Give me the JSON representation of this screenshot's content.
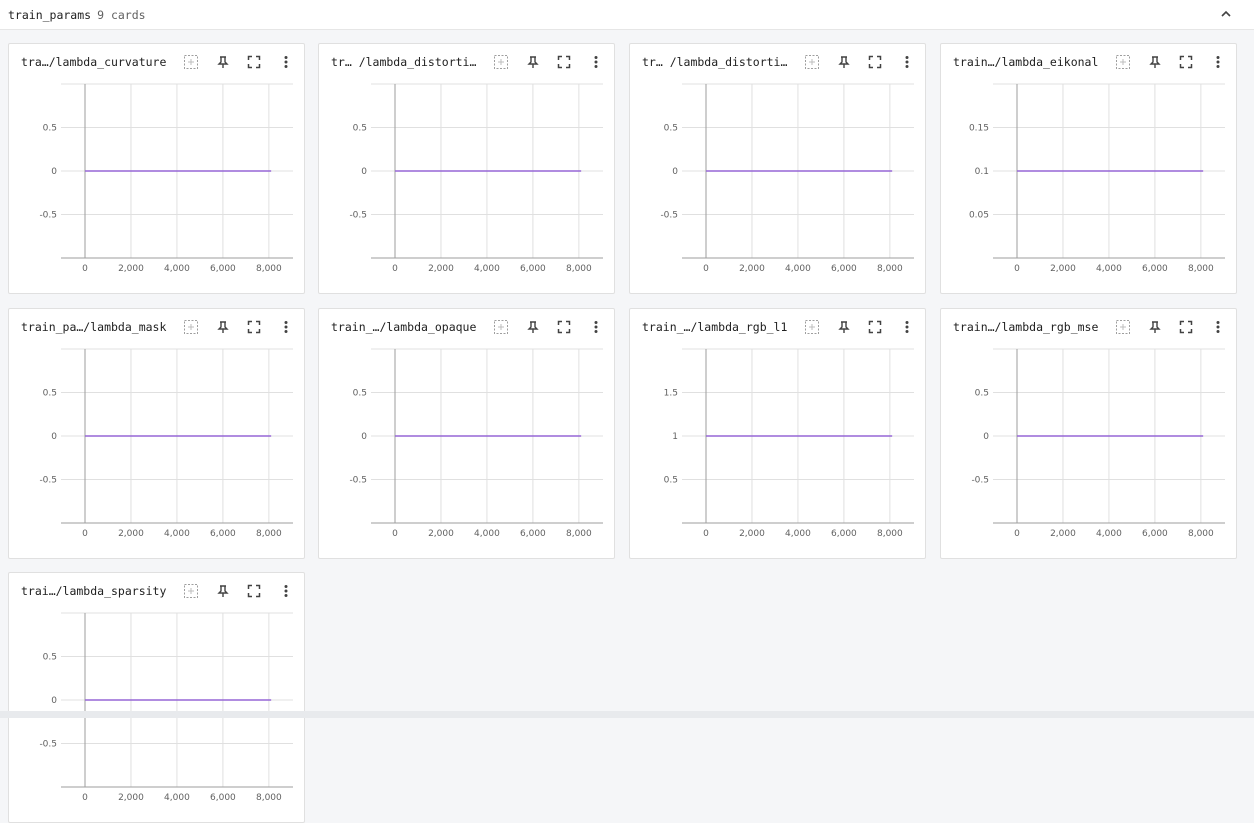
{
  "header": {
    "title": "train_params",
    "count": "9 cards"
  },
  "colors": {
    "line": "#9567d6",
    "grid": "#e0e0e0",
    "axis": "#9e9e9e"
  },
  "icons": [
    "fit-domain-icon",
    "pin-icon",
    "fullscreen-icon",
    "more-vert-icon"
  ],
  "cards": [
    {
      "title": "tra…/lambda_curvature",
      "yticks": [
        "0.5",
        "0",
        "-0.5"
      ]
    },
    {
      "title": "tr… /lambda_distorti…",
      "yticks": [
        "0.5",
        "0",
        "-0.5"
      ]
    },
    {
      "title": "tr… /lambda_distorti…",
      "yticks": [
        "0.5",
        "0",
        "-0.5"
      ]
    },
    {
      "title": "train…/lambda_eikonal",
      "yticks": [
        "0.15",
        "0.1",
        "0.05"
      ]
    },
    {
      "title": "train_pa…/lambda_mask",
      "yticks": [
        "0.5",
        "0",
        "-0.5"
      ]
    },
    {
      "title": "train_…/lambda_opaque",
      "yticks": [
        "0.5",
        "0",
        "-0.5"
      ]
    },
    {
      "title": "train_…/lambda_rgb_l1",
      "yticks": [
        "1.5",
        "1",
        "0.5"
      ]
    },
    {
      "title": "train…/lambda_rgb_mse",
      "yticks": [
        "0.5",
        "0",
        "-0.5"
      ]
    },
    {
      "title": "trai…/lambda_sparsity",
      "yticks": [
        "0.5",
        "0",
        "-0.5"
      ]
    }
  ],
  "chart_data": [
    {
      "type": "line",
      "x": [
        0,
        8100
      ],
      "series": [
        {
          "values": [
            0,
            0
          ]
        }
      ],
      "ylim": [
        -1,
        1
      ],
      "xticks": [
        "0",
        "2,000",
        "4,000",
        "6,000",
        "8,000"
      ],
      "yticks": [
        "0.5",
        "0",
        "-0.5"
      ]
    },
    {
      "type": "line",
      "x": [
        0,
        8100
      ],
      "series": [
        {
          "values": [
            0,
            0
          ]
        }
      ],
      "ylim": [
        -1,
        1
      ],
      "xticks": [
        "0",
        "2,000",
        "4,000",
        "6,000",
        "8,000"
      ],
      "yticks": [
        "0.5",
        "0",
        "-0.5"
      ]
    },
    {
      "type": "line",
      "x": [
        0,
        8100
      ],
      "series": [
        {
          "values": [
            0,
            0
          ]
        }
      ],
      "ylim": [
        -1,
        1
      ],
      "xticks": [
        "0",
        "2,000",
        "4,000",
        "6,000",
        "8,000"
      ],
      "yticks": [
        "0.5",
        "0",
        "-0.5"
      ]
    },
    {
      "type": "line",
      "x": [
        0,
        8100
      ],
      "series": [
        {
          "values": [
            0.1,
            0.1
          ]
        }
      ],
      "ylim": [
        0,
        0.2
      ],
      "xticks": [
        "0",
        "2,000",
        "4,000",
        "6,000",
        "8,000"
      ],
      "yticks": [
        "0.15",
        "0.1",
        "0.05"
      ]
    },
    {
      "type": "line",
      "x": [
        0,
        8100
      ],
      "series": [
        {
          "values": [
            0,
            0
          ]
        }
      ],
      "ylim": [
        -1,
        1
      ],
      "xticks": [
        "0",
        "2,000",
        "4,000",
        "6,000",
        "8,000"
      ],
      "yticks": [
        "0.5",
        "0",
        "-0.5"
      ]
    },
    {
      "type": "line",
      "x": [
        0,
        8100
      ],
      "series": [
        {
          "values": [
            0,
            0
          ]
        }
      ],
      "ylim": [
        -1,
        1
      ],
      "xticks": [
        "0",
        "2,000",
        "4,000",
        "6,000",
        "8,000"
      ],
      "yticks": [
        "0.5",
        "0",
        "-0.5"
      ]
    },
    {
      "type": "line",
      "x": [
        0,
        8100
      ],
      "series": [
        {
          "values": [
            1,
            1
          ]
        }
      ],
      "ylim": [
        0,
        2
      ],
      "xticks": [
        "0",
        "2,000",
        "4,000",
        "6,000",
        "8,000"
      ],
      "yticks": [
        "1.5",
        "1",
        "0.5"
      ]
    },
    {
      "type": "line",
      "x": [
        0,
        8100
      ],
      "series": [
        {
          "values": [
            0,
            0
          ]
        }
      ],
      "ylim": [
        -1,
        1
      ],
      "xticks": [
        "0",
        "2,000",
        "4,000",
        "6,000",
        "8,000"
      ],
      "yticks": [
        "0.5",
        "0",
        "-0.5"
      ]
    },
    {
      "type": "line",
      "x": [
        0,
        8100
      ],
      "series": [
        {
          "values": [
            0,
            0
          ]
        }
      ],
      "ylim": [
        -1,
        1
      ],
      "xticks": [
        "0",
        "2,000",
        "4,000",
        "6,000",
        "8,000"
      ],
      "yticks": [
        "0.5",
        "0",
        "-0.5"
      ]
    }
  ]
}
